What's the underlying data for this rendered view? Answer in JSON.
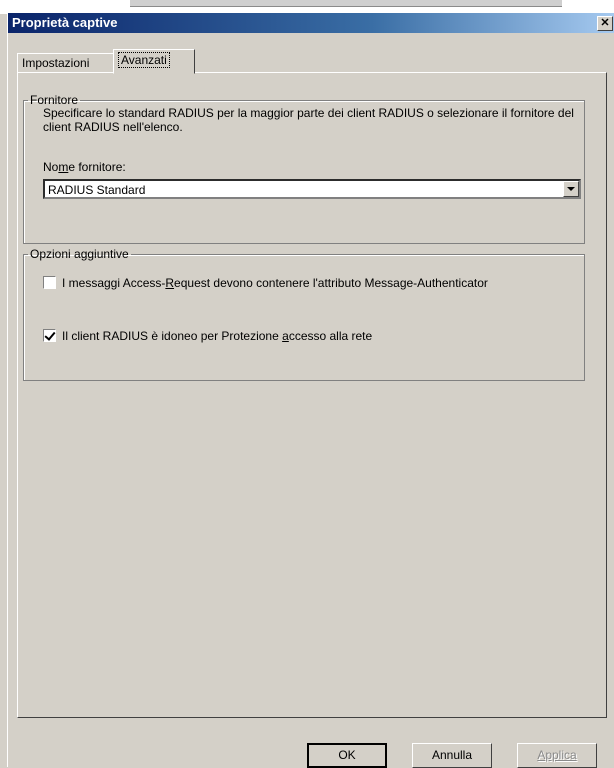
{
  "dialog": {
    "title": "Proprietà captive",
    "close_glyph": "✕"
  },
  "tabs": [
    {
      "label": "Impostazioni",
      "selected": false
    },
    {
      "label": "Avanzati",
      "selected": true
    }
  ],
  "vendor_group": {
    "legend": "Fornitore",
    "description": "Specificare lo standard RADIUS per la maggior parte dei client RADIUS o selezionare il fornitore del client RADIUS nell'elenco.",
    "label_prefix": "No",
    "label_underlined": "m",
    "label_suffix": "e fornitore:",
    "selected_value": "RADIUS Standard"
  },
  "options_group": {
    "legend": "Opzioni aggiuntive",
    "opt1_before": "I messaggi Access-",
    "opt1_underlined": "R",
    "opt1_after": "equest devono contenere l'attributo Message-Authenticator",
    "opt1_checked": false,
    "opt2_before": "Il client RADIUS è idoneo per Protezione ",
    "opt2_underlined": "a",
    "opt2_after": "ccesso alla rete",
    "opt2_checked": true
  },
  "buttons": {
    "ok": "OK",
    "cancel": "Annulla",
    "apply": "Applica"
  },
  "colors": {
    "titlebar_start": "#0a246a",
    "face": "#d4d0c8",
    "disabled_text": "#8a8a8a"
  }
}
